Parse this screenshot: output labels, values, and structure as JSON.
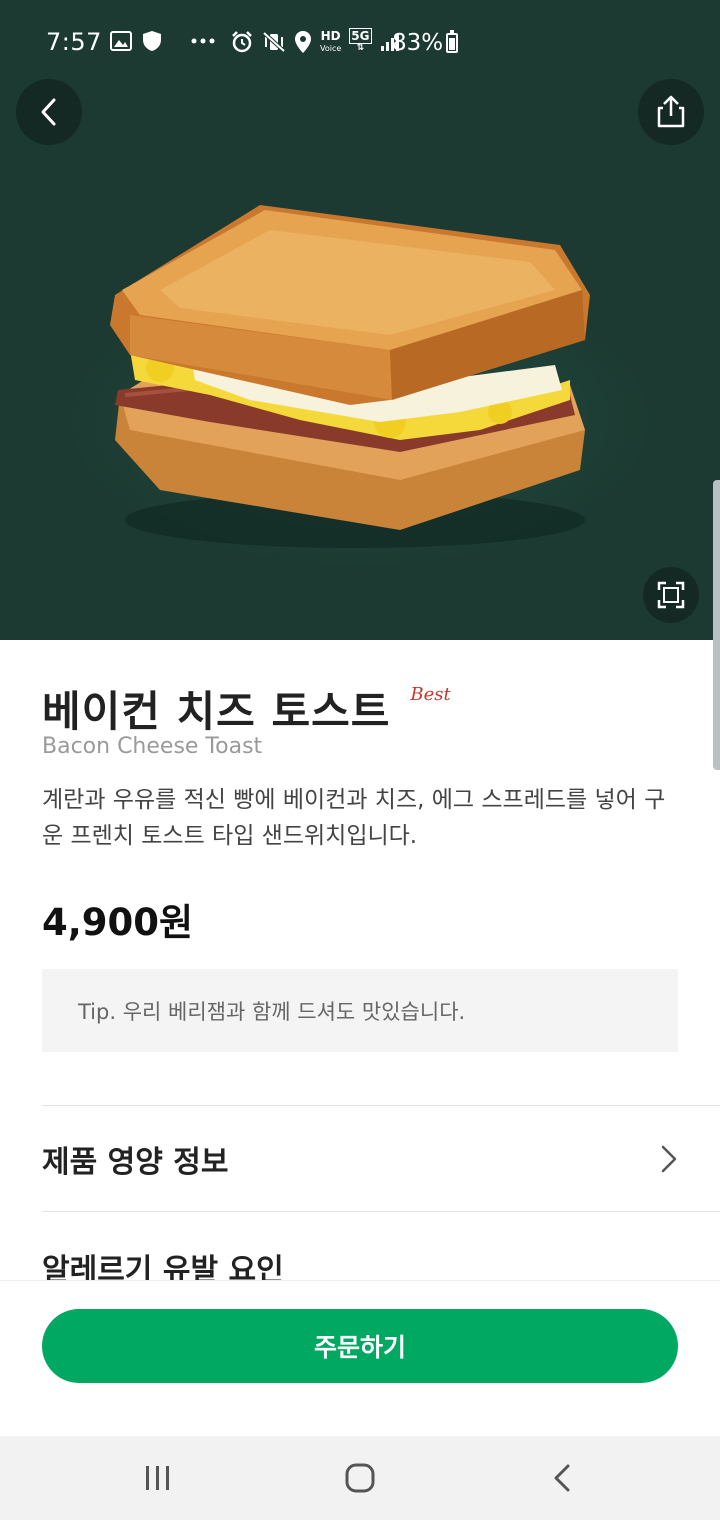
{
  "status_bar": {
    "time": "7:57",
    "battery": "83%",
    "network": "5G",
    "hd_label": "HD"
  },
  "product": {
    "name_ko": "베이컨 치즈 토스트",
    "badge": "Best",
    "name_en": "Bacon Cheese Toast",
    "description": "계란과 우유를 적신 빵에 베이컨과 치즈, 에그 스프레드를 넣어 구운 프렌치 토스트 타입 샌드위치입니다.",
    "price": "4,900원",
    "tip": "Tip. 우리 베리잼과 함께 드셔도 맛있습니다."
  },
  "sections": {
    "nutrition_label": "제품 영양 정보",
    "allergy_label": "알레르기 유발 요인"
  },
  "actions": {
    "order_label": "주문하기"
  },
  "icons": {
    "back": "chevron-left-icon",
    "share": "share-icon",
    "expand": "fullscreen-icon",
    "row_arrow": "chevron-right-icon"
  },
  "colors": {
    "hero_bg": "#1c3a31",
    "order_button": "#00a862",
    "badge": "#c23a2e"
  }
}
